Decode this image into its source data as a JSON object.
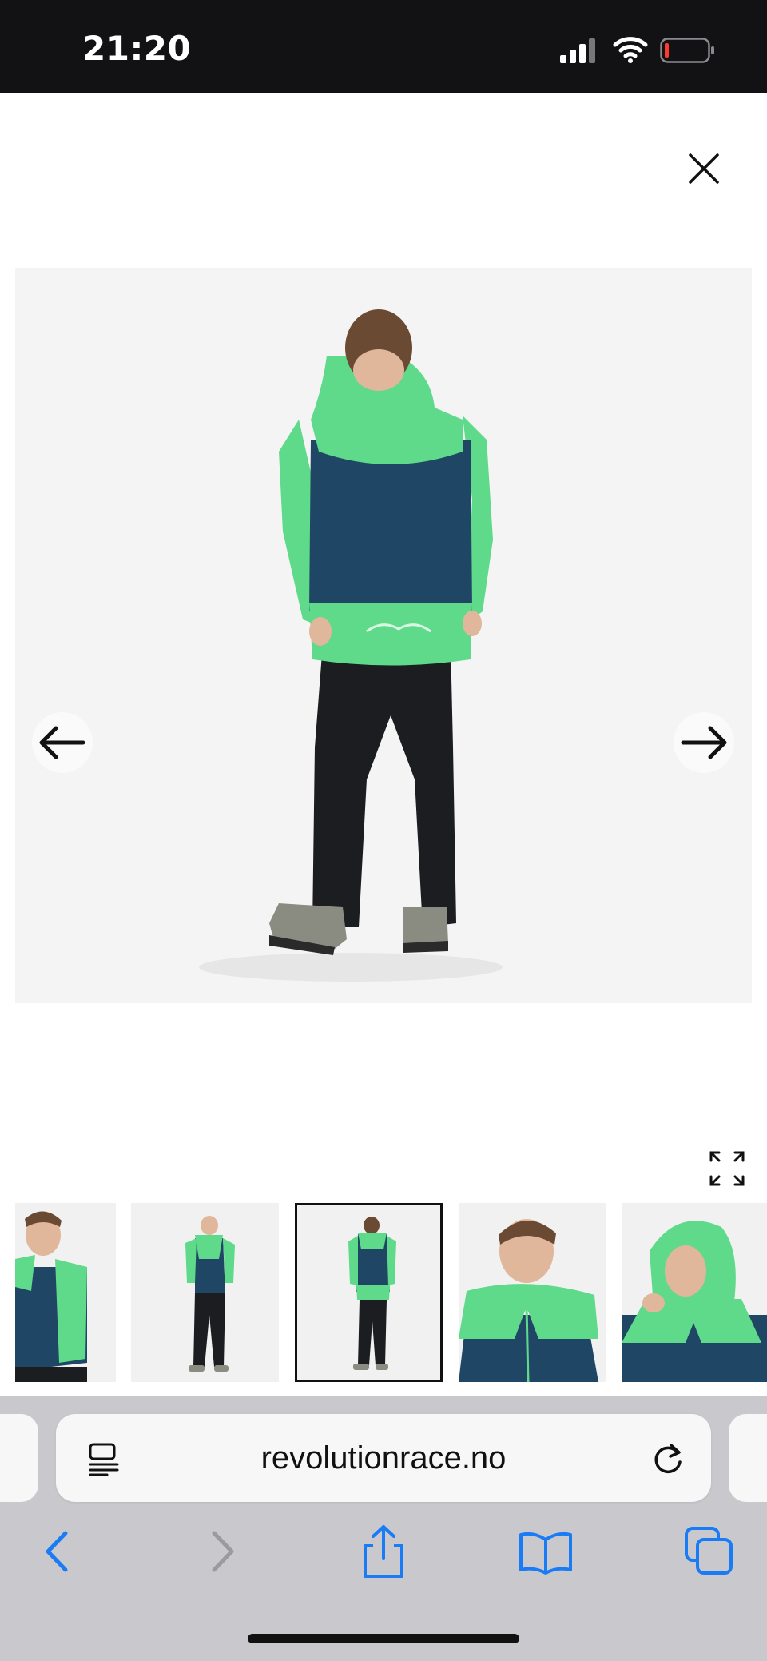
{
  "status_bar": {
    "time": "21:20",
    "icons": [
      "cellular-signal-icon",
      "wifi-icon",
      "battery-low-icon"
    ]
  },
  "gallery": {
    "close_icon": "close-icon",
    "prev_icon": "arrow-left-icon",
    "next_icon": "arrow-right-icon",
    "expand_icon": "expand-icon",
    "main_image": "boy in green and navy jacket and black pants, back view",
    "selected_thumbnail": 3,
    "thumbnails": [
      "front close-up",
      "front full body",
      "back full body",
      "smiling close-up",
      "hood detail"
    ]
  },
  "browser": {
    "url": "revolutionrace.no",
    "toolbar": [
      "back-icon",
      "forward-icon",
      "share-icon",
      "bookmarks-icon",
      "tabs-icon"
    ]
  },
  "colors": {
    "jacket_green": "#5fd98a",
    "jacket_navy": "#1f4665",
    "pants_black": "#1c1d20",
    "ios_blue": "#1a7cf5",
    "disabled_gray": "#9a9aa0"
  }
}
